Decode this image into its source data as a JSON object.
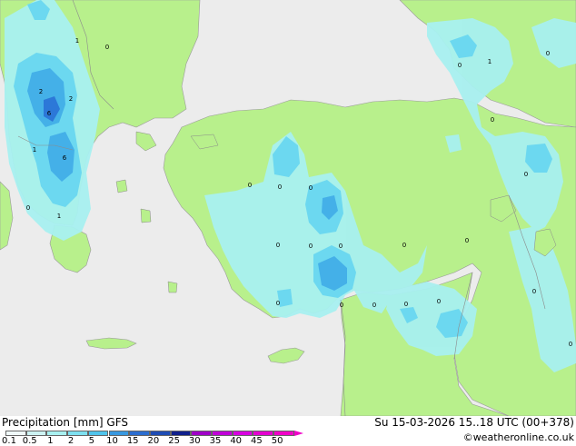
{
  "title": "Precipitation [mm]",
  "model": "GFS",
  "valid_time": "Su 15-03-2026 15..18 UTC (00+378)",
  "credit": "©weatheronline.co.uk",
  "colors": {
    "sea": "#ececec",
    "land": "#b8f08c",
    "precip_light": "#a8f0f0",
    "precip_mid": "#6cd8f0",
    "precip_heavy": "#44b0e8",
    "precip_max": "#2c78d8"
  },
  "legend": {
    "ticks": [
      "0.1",
      "0.5",
      "1",
      "2",
      "5",
      "10",
      "15",
      "20",
      "25",
      "30",
      "35",
      "40",
      "45",
      "50"
    ],
    "colors": [
      "#f0fafa",
      "#cdf3f3",
      "#a8f0f0",
      "#7ee0f0",
      "#50c4ec",
      "#3898e0",
      "#2c6ed0",
      "#1e4cb4",
      "#10208c",
      "#a000c8",
      "#c000d8",
      "#d800e0",
      "#e400d0",
      "#f000c8"
    ]
  },
  "map_labels": [
    "2",
    "2",
    "6",
    "1",
    "6",
    "0",
    "1",
    "0",
    "1",
    "0",
    "1",
    "0",
    "0",
    "0",
    "0",
    "0",
    "0",
    "0",
    "0",
    "0",
    "0",
    "0",
    "0",
    "0",
    "0",
    "0",
    "0",
    "0",
    "0",
    "0",
    "0",
    "0",
    "0"
  ]
}
